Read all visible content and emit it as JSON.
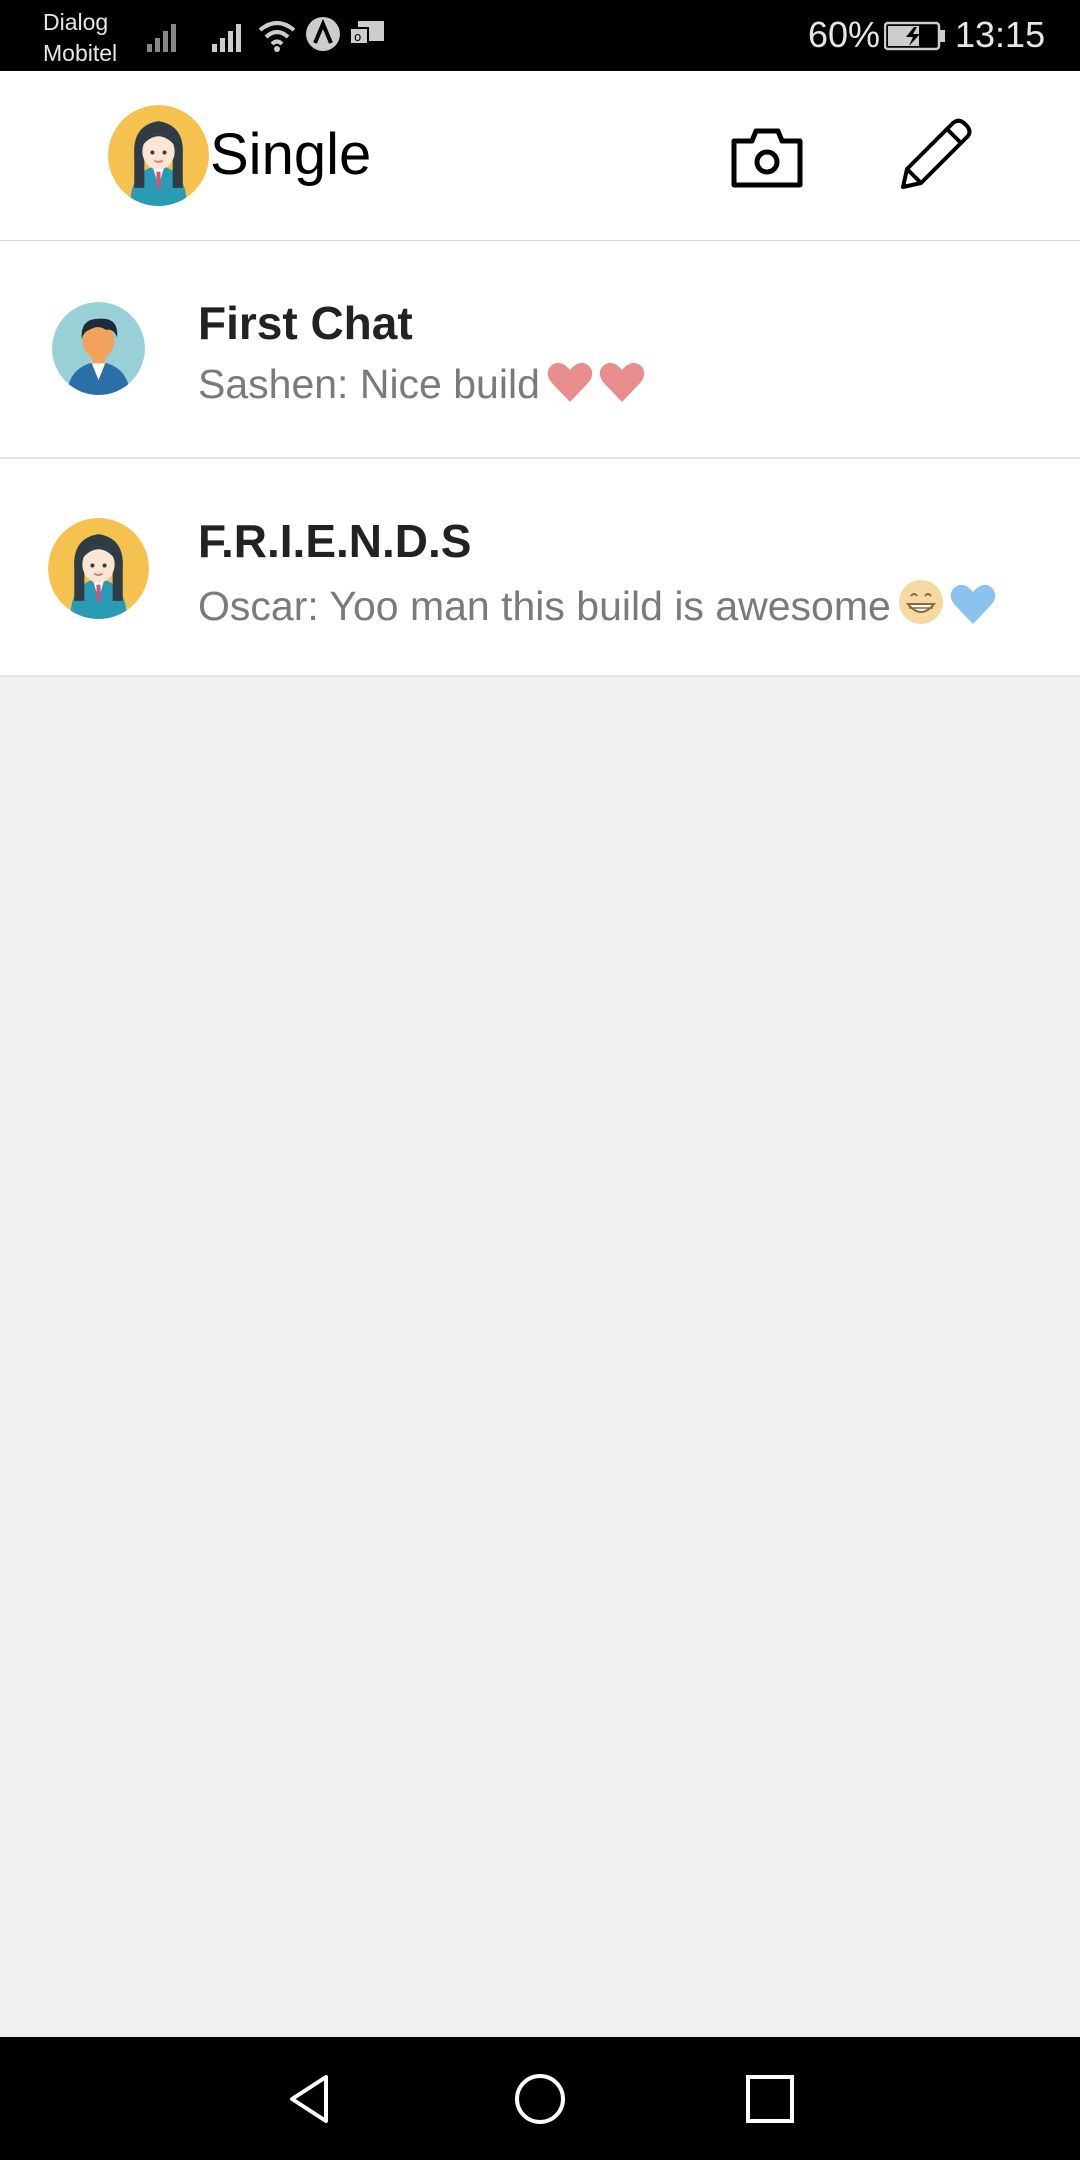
{
  "status_bar": {
    "carrier_line1": "Dialog",
    "carrier_line2": "Mobitel",
    "battery_percent": "60%",
    "time": "13:15",
    "icons": [
      "signal-icon",
      "signal-icon",
      "wifi-icon",
      "app-notification-icon",
      "message-icon",
      "battery-charging-icon"
    ]
  },
  "app_bar": {
    "title": "Single",
    "icons": [
      "profile-avatar",
      "camera-icon",
      "pencil-icon"
    ]
  },
  "chats": [
    {
      "name": "First Chat",
      "preview": "Sashen: Nice build",
      "emojis": [
        "red-heart",
        "red-heart"
      ],
      "avatar": "man-avatar"
    },
    {
      "name": "F.R.I.E.N.D.S",
      "preview": "Oscar: Yoo man this build is awesome",
      "emojis": [
        "grinning-face",
        "blue-heart"
      ],
      "avatar": "woman-avatar"
    }
  ],
  "nav_bar": {
    "icons": [
      "back-icon",
      "home-icon",
      "recents-icon"
    ]
  },
  "colors": {
    "app_bar_bg": "#ffffff",
    "list_bg": "#f0f0f0",
    "text_primary": "#222222",
    "text_secondary": "#7a7a7a",
    "status_bar_bg": "#000000"
  }
}
